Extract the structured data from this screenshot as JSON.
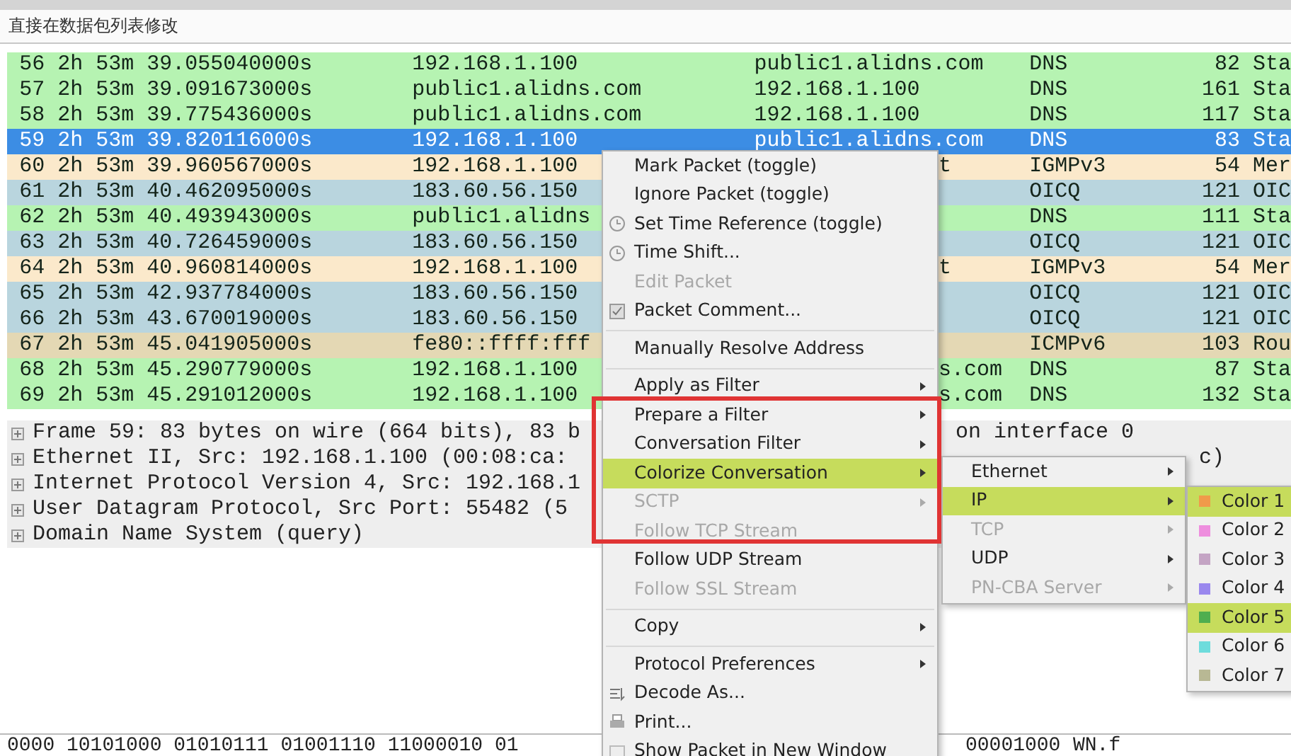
{
  "filter_bar": {
    "text": "直接在数据包列表修改"
  },
  "packet_list": {
    "rows": [
      {
        "no": "56",
        "time": "2h 53m 39.055040000s",
        "source": "192.168.1.100",
        "destination": "public1.alidns.com",
        "protocol": "DNS",
        "length": "82",
        "info": "Sta",
        "color": "#b6f3b2",
        "selected": false
      },
      {
        "no": "57",
        "time": "2h 53m 39.091673000s",
        "source": "public1.alidns.com",
        "destination": "192.168.1.100",
        "protocol": "DNS",
        "length": "161",
        "info": "Sta",
        "color": "#b6f3b2",
        "selected": false
      },
      {
        "no": "58",
        "time": "2h 53m 39.775436000s",
        "source": "public1.alidns.com",
        "destination": "192.168.1.100",
        "protocol": "DNS",
        "length": "117",
        "info": "Sta",
        "color": "#b6f3b2",
        "selected": false
      },
      {
        "no": "59",
        "time": "2h 53m 39.820116000s",
        "source": "192.168.1.100",
        "destination": "public1.alidns.com",
        "protocol": "DNS",
        "length": "83",
        "info": "Sta",
        "selected": true
      },
      {
        "no": "60",
        "time": "2h 53m 39.960567000s",
        "source": "192.168.1.100",
        "destination_tail": "t",
        "protocol": "IGMPv3",
        "length": "54",
        "info": "Mer",
        "color": "#fbe9cb",
        "selected": false
      },
      {
        "no": "61",
        "time": "2h 53m 40.462095000s",
        "source": "183.60.56.150",
        "protocol": "OICQ",
        "length": "121",
        "info": "OIC",
        "color": "#b9d5de",
        "selected": false
      },
      {
        "no": "62",
        "time": "2h 53m 40.493943000s",
        "source": "public1.alidns",
        "protocol": "DNS",
        "length": "111",
        "info": "Sta",
        "color": "#b6f3b2",
        "selected": false
      },
      {
        "no": "63",
        "time": "2h 53m 40.726459000s",
        "source": "183.60.56.150",
        "protocol": "OICQ",
        "length": "121",
        "info": "OIC",
        "color": "#b9d5de",
        "selected": false
      },
      {
        "no": "64",
        "time": "2h 53m 40.960814000s",
        "source": "192.168.1.100",
        "destination_tail": "t",
        "protocol": "IGMPv3",
        "length": "54",
        "info": "Mer",
        "color": "#fbe9cb",
        "selected": false
      },
      {
        "no": "65",
        "time": "2h 53m 42.937784000s",
        "source": "183.60.56.150",
        "protocol": "OICQ",
        "length": "121",
        "info": "OIC",
        "color": "#b9d5de",
        "selected": false
      },
      {
        "no": "66",
        "time": "2h 53m 43.670019000s",
        "source": "183.60.56.150",
        "protocol": "OICQ",
        "length": "121",
        "info": "OIC",
        "color": "#b9d5de",
        "selected": false
      },
      {
        "no": "67",
        "time": "2h 53m 45.041905000s",
        "source": "fe80::ffff:fff",
        "protocol": "ICMPv6",
        "length": "103",
        "info": "Rou",
        "color": "#e4d8b4",
        "selected": false
      },
      {
        "no": "68",
        "time": "2h 53m 45.290779000s",
        "source": "192.168.1.100",
        "destination_tail": "s.com",
        "protocol": "DNS",
        "length": "87",
        "info": "Sta",
        "color": "#b6f3b2",
        "selected": false
      },
      {
        "no": "69",
        "time": "2h 53m 45.291012000s",
        "source": "192.168.1.100",
        "destination_tail": "s.com",
        "protocol": "DNS",
        "length": "132",
        "info": "Sta",
        "color": "#b6f3b2",
        "selected": false
      }
    ]
  },
  "details": [
    {
      "text": "Frame 59: 83 bytes on wire (664 bits), 83 b",
      "tail": "on interface 0"
    },
    {
      "text": "Ethernet II, Src: 192.168.1.100 (00:08:ca:",
      "tail": "c)"
    },
    {
      "text": "Internet Protocol Version 4, Src: 192.168.1"
    },
    {
      "text": "User Datagram Protocol, Src Port: 55482 (5"
    },
    {
      "text": "Domain Name System (query)"
    }
  ],
  "bytes": {
    "text": "0000   10101000 01010111 01001110 11000010 01",
    "tail": "00001000",
    "ascii": "WN.f"
  },
  "context_menu": [
    {
      "kind": "item",
      "label": "Mark Packet (toggle)",
      "disabled": false,
      "submenu": false,
      "selected": false
    },
    {
      "kind": "item",
      "label": "Ignore Packet (toggle)",
      "disabled": false,
      "submenu": false,
      "selected": false
    },
    {
      "kind": "item",
      "label": "Set Time Reference (toggle)",
      "disabled": false,
      "submenu": false,
      "selected": false
    },
    {
      "kind": "item",
      "label": "Time Shift...",
      "disabled": false,
      "submenu": false,
      "selected": false
    },
    {
      "kind": "item",
      "label": "Edit Packet",
      "disabled": true,
      "submenu": false,
      "selected": false
    },
    {
      "kind": "item",
      "label": "Packet Comment...",
      "disabled": false,
      "submenu": false,
      "selected": false
    },
    {
      "kind": "separator"
    },
    {
      "kind": "item",
      "label": "Manually Resolve Address",
      "disabled": false,
      "submenu": false,
      "selected": false
    },
    {
      "kind": "separator"
    },
    {
      "kind": "item",
      "label": "Apply as Filter",
      "disabled": false,
      "submenu": true,
      "selected": false
    },
    {
      "kind": "item",
      "label": "Prepare a Filter",
      "disabled": false,
      "submenu": true,
      "selected": false
    },
    {
      "kind": "item",
      "label": "Conversation Filter",
      "disabled": false,
      "submenu": true,
      "selected": false
    },
    {
      "kind": "item",
      "label": "Colorize Conversation",
      "disabled": false,
      "submenu": true,
      "selected": true
    },
    {
      "kind": "item",
      "label": "SCTP",
      "disabled": true,
      "submenu": true,
      "selected": false
    },
    {
      "kind": "item",
      "label": "Follow TCP Stream",
      "disabled": true,
      "submenu": false,
      "selected": false
    },
    {
      "kind": "item",
      "label": "Follow UDP Stream",
      "disabled": false,
      "submenu": false,
      "selected": false
    },
    {
      "kind": "item",
      "label": "Follow SSL Stream",
      "disabled": true,
      "submenu": false,
      "selected": false
    },
    {
      "kind": "separator"
    },
    {
      "kind": "item",
      "label": "Copy",
      "disabled": false,
      "submenu": true,
      "selected": false
    },
    {
      "kind": "separator"
    },
    {
      "kind": "item",
      "label": "Protocol Preferences",
      "disabled": false,
      "submenu": true,
      "selected": false
    },
    {
      "kind": "item",
      "label": "Decode As...",
      "disabled": false,
      "submenu": false,
      "selected": false
    },
    {
      "kind": "item",
      "label": "Print...",
      "disabled": false,
      "submenu": false,
      "selected": false
    },
    {
      "kind": "item",
      "label": "Show Packet in New Window",
      "disabled": false,
      "submenu": false,
      "selected": false
    }
  ],
  "colorize_submenu": [
    {
      "label": "Ethernet",
      "disabled": false,
      "submenu": true,
      "selected": false
    },
    {
      "label": "IP",
      "disabled": false,
      "submenu": true,
      "selected": true
    },
    {
      "label": "TCP",
      "disabled": true,
      "submenu": true,
      "selected": false
    },
    {
      "label": "UDP",
      "disabled": false,
      "submenu": true,
      "selected": false
    },
    {
      "label": "PN-CBA Server",
      "disabled": true,
      "submenu": true,
      "selected": false
    }
  ],
  "color_submenu": [
    {
      "label": "Color 1",
      "color": "#f09a4a",
      "selected": true
    },
    {
      "label": "Color 2",
      "color": "#ee8ede",
      "selected": false
    },
    {
      "label": "Color 3",
      "color": "#c4a4c4",
      "selected": false
    },
    {
      "label": "Color 4",
      "color": "#9a88ee",
      "selected": false
    },
    {
      "label": "Color 5",
      "color": "#4fae4f",
      "selected": true
    },
    {
      "label": "Color 6",
      "color": "#6edcdc",
      "selected": false
    },
    {
      "label": "Color 7",
      "color": "#b8b894",
      "selected": false
    }
  ]
}
